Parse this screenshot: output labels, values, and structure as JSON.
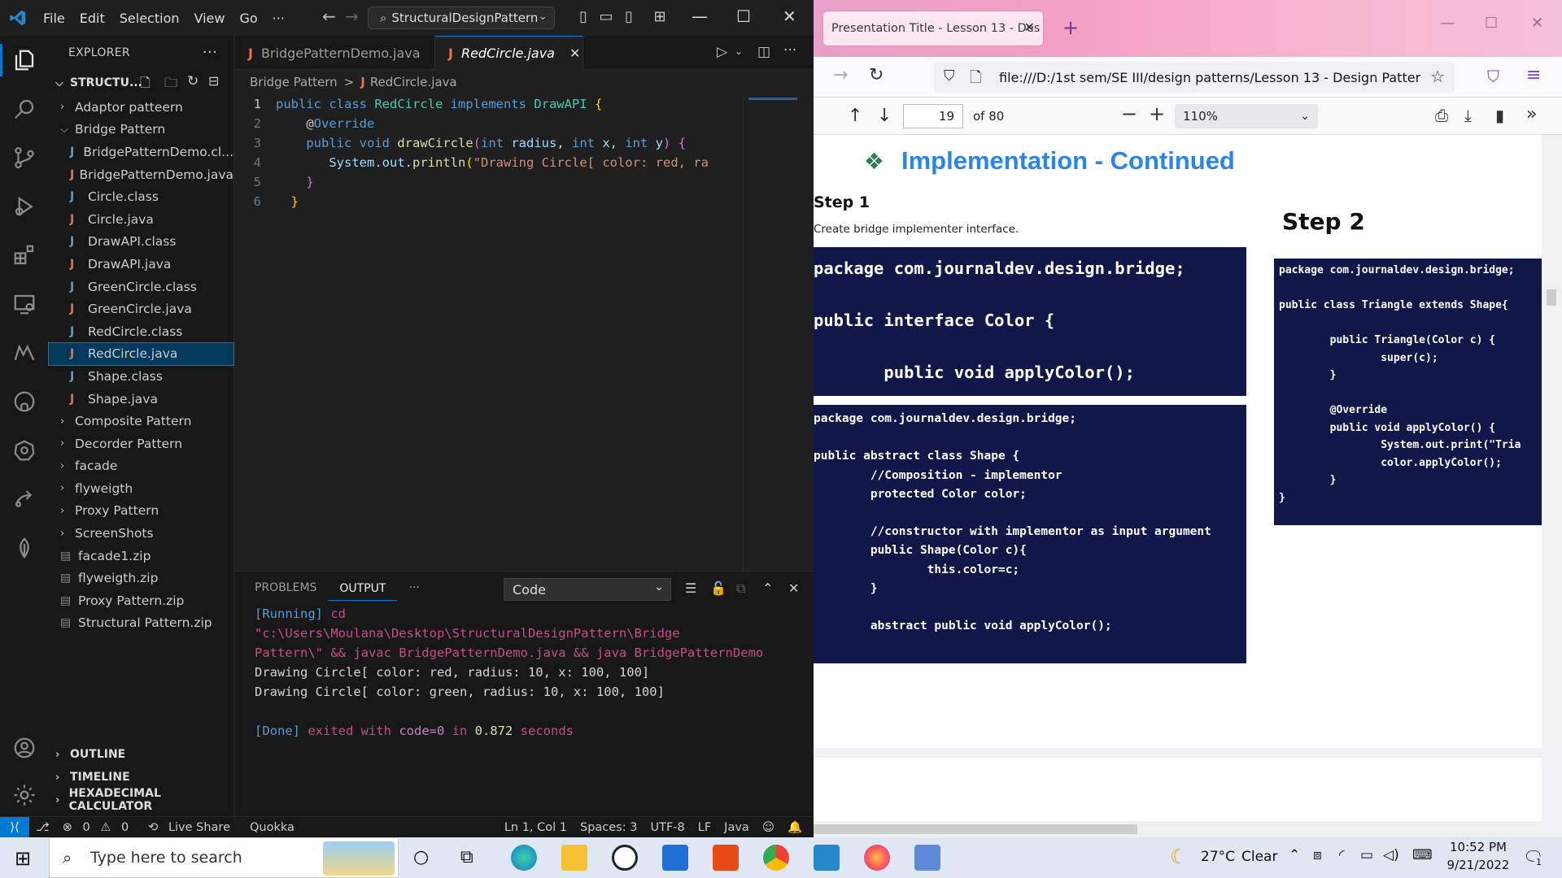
{
  "vscode": {
    "menu": [
      "File",
      "Edit",
      "Selection",
      "View",
      "Go"
    ],
    "menu_more": "···",
    "command_center": "StructuralDesignPattern",
    "explorer_title": "EXPLORER",
    "explorer_more": "···",
    "workspace": "STRUCTU...",
    "tree": [
      {
        "label": "Adaptor patteern",
        "type": "folder",
        "open": false,
        "depth": 0
      },
      {
        "label": "Bridge Pattern",
        "type": "folder",
        "open": true,
        "depth": 0
      },
      {
        "label": "BridgePatternDemo.cl...",
        "type": "class",
        "depth": 1
      },
      {
        "label": "BridgePatternDemo.java",
        "type": "java",
        "depth": 1
      },
      {
        "label": "Circle.class",
        "type": "class",
        "depth": 1
      },
      {
        "label": "Circle.java",
        "type": "java",
        "depth": 1
      },
      {
        "label": "DrawAPI.class",
        "type": "class",
        "depth": 1
      },
      {
        "label": "DrawAPI.java",
        "type": "java",
        "depth": 1
      },
      {
        "label": "GreenCircle.class",
        "type": "class",
        "depth": 1
      },
      {
        "label": "GreenCircle.java",
        "type": "java",
        "depth": 1
      },
      {
        "label": "RedCircle.class",
        "type": "class",
        "depth": 1
      },
      {
        "label": "RedCircle.java",
        "type": "java",
        "depth": 1,
        "selected": true
      },
      {
        "label": "Shape.class",
        "type": "class",
        "depth": 1
      },
      {
        "label": "Shape.java",
        "type": "java",
        "depth": 1
      },
      {
        "label": "Composite Pattern",
        "type": "folder",
        "open": false,
        "depth": 0
      },
      {
        "label": "Decorder Pattern",
        "type": "folder",
        "open": false,
        "depth": 0
      },
      {
        "label": "facade",
        "type": "folder",
        "open": false,
        "depth": 0
      },
      {
        "label": "flyweigth",
        "type": "folder",
        "open": false,
        "depth": 0
      },
      {
        "label": "Proxy Pattern",
        "type": "folder",
        "open": false,
        "depth": 0
      },
      {
        "label": "ScreenShots",
        "type": "folder",
        "open": false,
        "depth": 0
      },
      {
        "label": "facade1.zip",
        "type": "zip",
        "depth": 0
      },
      {
        "label": "flyweigth.zip",
        "type": "zip",
        "depth": 0
      },
      {
        "label": "Proxy Pattern.zip",
        "type": "zip",
        "depth": 0
      },
      {
        "label": "Structural Pattern.zip",
        "type": "zip",
        "depth": 0
      }
    ],
    "sections": [
      "OUTLINE",
      "TIMELINE",
      "HEXADECIMAL CALCULATOR"
    ],
    "tabs": [
      {
        "label": "BridgePatternDemo.java",
        "active": false
      },
      {
        "label": "RedCircle.java",
        "active": true
      }
    ],
    "breadcrumb": {
      "folder": "Bridge Pattern",
      "sep": ">",
      "file": "RedCircle.java"
    },
    "code_lines": [
      {
        "n": "1",
        "tokens": [
          [
            "kw",
            "public "
          ],
          [
            "kw",
            "class "
          ],
          [
            "cn",
            "RedCircle "
          ],
          [
            "kw",
            "implements "
          ],
          [
            "cn",
            "DrawAPI "
          ],
          [
            "br",
            "{"
          ]
        ]
      },
      {
        "n": "2",
        "tokens": [
          [
            "pl",
            "    "
          ],
          [
            "an",
            "@"
          ],
          [
            "kw",
            "Override"
          ]
        ]
      },
      {
        "n": "3",
        "tokens": [
          [
            "pl",
            "    "
          ],
          [
            "kw",
            "public "
          ],
          [
            "kw",
            "void "
          ],
          [
            "fn",
            "drawCircle"
          ],
          [
            "br2",
            "("
          ],
          [
            "kw",
            "int "
          ],
          [
            "vr",
            "radius"
          ],
          [
            "pl",
            ", "
          ],
          [
            "kw",
            "int "
          ],
          [
            "vr",
            "x"
          ],
          [
            "pl",
            ", "
          ],
          [
            "kw",
            "int "
          ],
          [
            "vr",
            "y"
          ],
          [
            "br2",
            ")"
          ],
          [
            "pl",
            " "
          ],
          [
            "br2",
            "{"
          ]
        ]
      },
      {
        "n": "4",
        "tokens": [
          [
            "pl",
            "       "
          ],
          [
            "vr",
            "System"
          ],
          [
            "pl",
            "."
          ],
          [
            "vr",
            "out"
          ],
          [
            "pl",
            "."
          ],
          [
            "fn",
            "println"
          ],
          [
            "br",
            "("
          ],
          [
            "st",
            "\"Drawing Circle[ color: red, ra"
          ]
        ]
      },
      {
        "n": "5",
        "tokens": [
          [
            "pl",
            "    "
          ],
          [
            "br2",
            "}"
          ]
        ]
      },
      {
        "n": "6",
        "tokens": [
          [
            "pl",
            "  "
          ],
          [
            "br",
            "}"
          ]
        ]
      }
    ],
    "panel_tabs": [
      "PROBLEMS",
      "OUTPUT"
    ],
    "panel_more": "···",
    "output_channel": "Code",
    "output": {
      "run_tag": "[Running]",
      "cmd1": " cd",
      "cmd2": "\"c:\\Users\\Moulana\\Desktop\\StructuralDesignPattern\\Bridge",
      "cmd3": "Pattern\\\" && javac BridgePatternDemo.java && java BridgePatternDemo",
      "line1": "Drawing Circle[ color: red, radius: 10, x: 100, 100]",
      "line2": "Drawing Circle[ color: green, radius: 10, x: 100, 100]",
      "done_tag": "[Done]",
      "exited": " exited with ",
      "code_eq": "code=0",
      "in": " in ",
      "secs": "0.872",
      "seconds": " seconds"
    },
    "status": {
      "errors": "0",
      "warnings": "0",
      "liveshare": "Live Share",
      "quokka": "Quokka",
      "position": "Ln 1, Col 1",
      "spaces": "Spaces: 3",
      "encoding": "UTF-8",
      "eol": "LF",
      "language": "Java"
    },
    "accent": "#0078d4"
  },
  "firefox": {
    "tab_title": "Presentation Title - Lesson 13 - Des",
    "url": "file:///D:/1st sem/SE III/design patterns/Lesson 13 - Design Patter",
    "pdf": {
      "page": "19",
      "of_pages": "of 80",
      "zoom": "110%",
      "title": "Implementation - Continued",
      "step1": "Step 1",
      "step1_desc": "Create bridge implementer interface.",
      "step2": "Step 2",
      "box1": "package com.journaldev.design.bridge;\n\npublic interface Color {\n\n       public void applyColor();",
      "box2": "package com.journaldev.design.bridge;\n\npublic abstract class Shape {\n        //Composition - implementor\n        protected Color color;\n\n        //constructor with implementor as input argument\n        public Shape(Color c){\n                this.color=c;\n        }\n\n        abstract public void applyColor();",
      "box3": "package com.journaldev.design.bridge;\n\npublic class Triangle extends Shape{\n\n        public Triangle(Color c) {\n                super(c);\n        }\n\n        @Override\n        public void applyColor() {\n                System.out.print(\"Tria\n                color.applyColor();\n        }\n}"
    }
  },
  "taskbar": {
    "search_placeholder": "Type here to search",
    "weather_temp": "27°C",
    "weather_desc": "Clear",
    "time": "10:52 PM",
    "date": "9/21/2022",
    "notif_count": "1"
  }
}
